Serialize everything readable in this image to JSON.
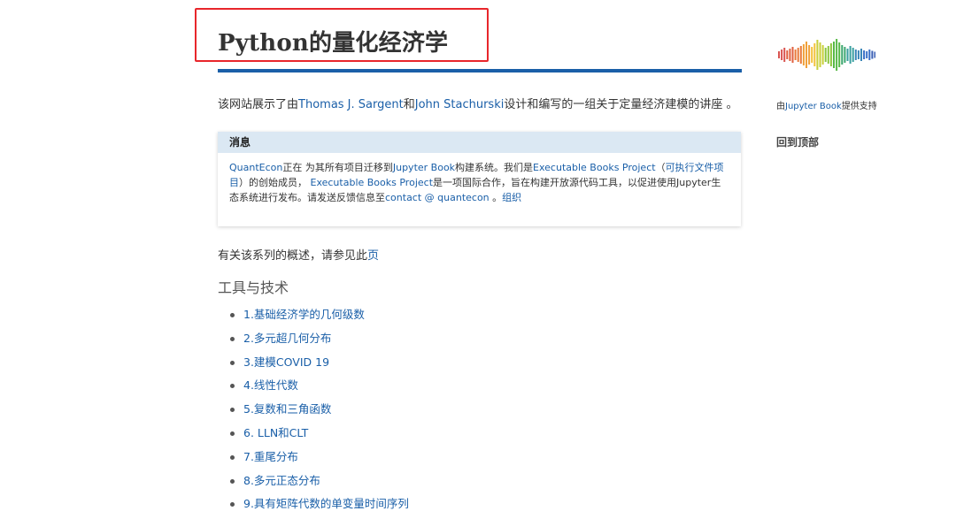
{
  "title": "Python的量化经济学",
  "intro": {
    "prefix": "该网站展示了由",
    "author1": "Thomas J. Sargent",
    "and": "和",
    "author2": "John Stachurski",
    "suffix": "设计和编写的一组关于定量经济建模的讲座 。"
  },
  "notice": {
    "heading": "消息",
    "quantecon": "QuantEcon",
    "t1": "正在 为其所有项目迁移到",
    "jupyter_book": "Jupyter Book",
    "t2": "构建系统。我们是",
    "ebp1": "Executable Books Project",
    "t3": "（",
    "exec_doc": "可执行文件项目",
    "t4": "）的创始成员， ",
    "ebp2": "Executable Books Project",
    "t5": "是一项国际合作，旨在构建开放源代码工具，以促进使用Jupyter生态系统进行发布。请发送反馈信息至",
    "contact": "contact @ quantecon",
    "t6": " 。",
    "org": "组织"
  },
  "overview": {
    "text": "有关该系列的概述，请参见此",
    "link": "页"
  },
  "section_title": "工具与技术",
  "lectures": [
    {
      "label": "1.基础经济学的几何级数"
    },
    {
      "label": "2.多元超几何分布"
    },
    {
      "label": "3.建模COVID 19"
    },
    {
      "label": "4.线性代数"
    },
    {
      "label": "5.复数和三角函数"
    },
    {
      "label": "6. LLN和CLT"
    },
    {
      "label": "7.重尾分布"
    },
    {
      "label": "8.多元正态分布"
    },
    {
      "label": "9.具有矩阵代数的单变量时间序列"
    }
  ],
  "sidebar": {
    "powered_prefix": "由",
    "powered_link": "Jupyter Book",
    "powered_suffix": "提供支持",
    "back_to_top": "回到顶部"
  },
  "colors": {
    "accent": "#1a5fa8",
    "highlight_box": "#e8262b",
    "notice_header_bg": "#dbe8f3"
  },
  "icons": {
    "logo": "quantecon-logo-icon"
  }
}
